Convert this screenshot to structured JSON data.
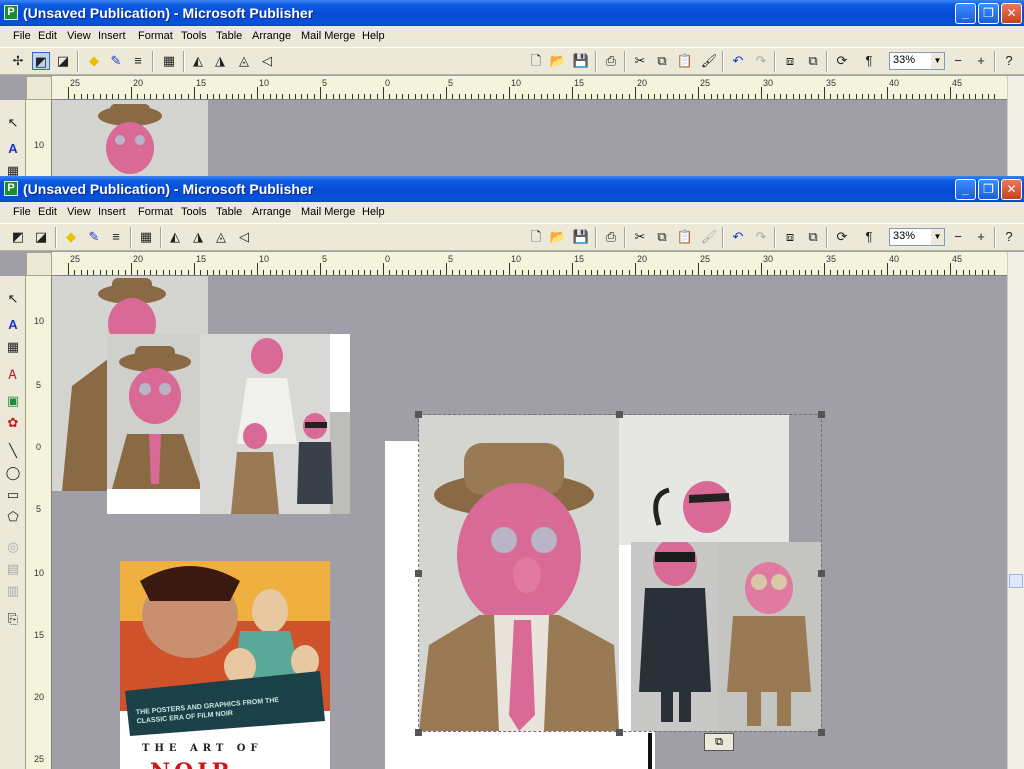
{
  "windows": [
    {
      "id": "back",
      "title": "(Unsaved Publication) - Microsoft Publisher"
    },
    {
      "id": "front",
      "title": "(Unsaved Publication) - Microsoft Publisher"
    }
  ],
  "menu": [
    "File",
    "Edit",
    "View",
    "Insert",
    "Format",
    "Tools",
    "Table",
    "Arrange",
    "Mail Merge",
    "Help"
  ],
  "toolbar": {
    "zoom_value": "33%"
  },
  "rulers": {
    "h_labels": [
      "25",
      "20",
      "15",
      "10",
      "5",
      "0",
      "5",
      "10",
      "15",
      "20",
      "25",
      "30",
      "35",
      "40",
      "45"
    ],
    "v_labels_back": [
      "10"
    ],
    "v_labels_front": [
      "10",
      "5",
      "0",
      "5",
      "10",
      "15",
      "20",
      "25"
    ]
  },
  "icons": {
    "title_buttons": [
      "minimize-icon",
      "restore-icon",
      "close-icon"
    ],
    "object_tools": [
      "pointer-icon",
      "text-box-icon",
      "table-icon",
      "wordart-icon",
      "picture-icon",
      "clip-art-icon",
      "line-icon",
      "oval-icon",
      "rectangle-icon",
      "autoshapes-icon"
    ]
  },
  "book_cover": {
    "tagline": "THE POSTERS AND GRAPHICS FROM THE CLASSIC ERA OF FILM NOIR",
    "title_line": "THE ART OF",
    "title_big": "NOIR"
  },
  "colors": {
    "title_bar": "#0a5ae0",
    "chrome": "#ece9d8",
    "workspace": "#a09fa8",
    "ruler": "#f4f4dc",
    "accent_pink": "#d86a95"
  }
}
